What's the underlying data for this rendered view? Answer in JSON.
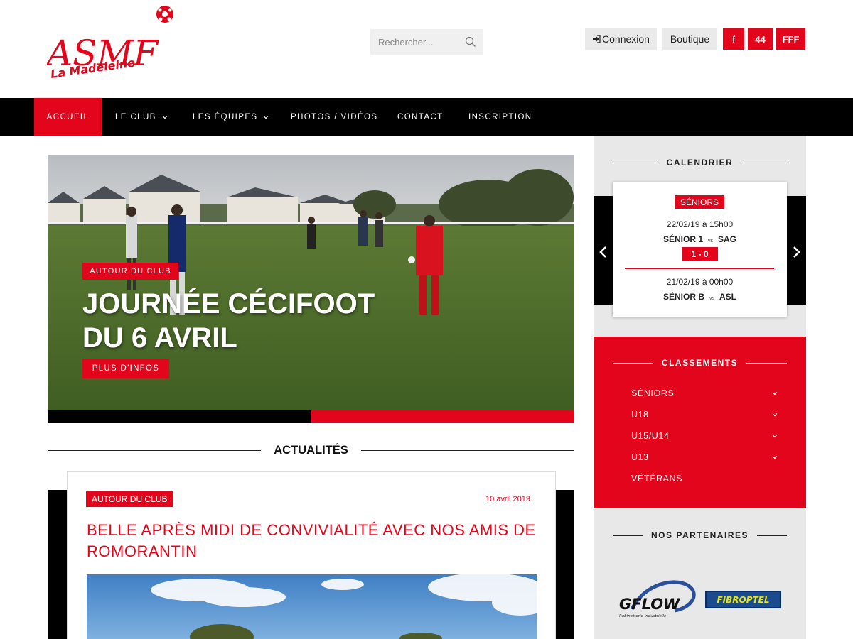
{
  "header": {
    "logo": {
      "main": "ASMF",
      "sub": "La Madeleine"
    },
    "search": {
      "placeholder": "Rechercher..."
    },
    "connexion_label": "Connexion",
    "boutique_label": "Boutique",
    "social": {
      "facebook": "f",
      "district": "44",
      "fff": "FFF"
    }
  },
  "nav": {
    "items": [
      {
        "label": "Accueil",
        "active": true
      },
      {
        "label": "Le Club",
        "dropdown": true
      },
      {
        "label": "Les Équipes",
        "dropdown": true
      },
      {
        "label": "Photos / Vidéos"
      },
      {
        "label": "Contact"
      },
      {
        "label": "Inscription"
      }
    ]
  },
  "hero": {
    "tag": "AUTOUR DU CLUB",
    "title_line1": "JOURNÉE CÉCIFOOT",
    "title_line2": "DU 6 AVRIL",
    "button": "PLUS D'INFOS",
    "progress": 0.5
  },
  "news": {
    "section_title": "ACTUALITÉS",
    "article": {
      "tag": "AUTOUR DU CLUB",
      "date": "10 avril 2019",
      "title": "BELLE APRÈS MIDI DE CONVIVIALITÉ AVEC NOS AMIS DE ROMORANTIN"
    }
  },
  "sidebar": {
    "calendar": {
      "title": "CALENDRIER",
      "category": "SÉNIORS",
      "matches": [
        {
          "date": "22/02/19 à 15h00",
          "home": "SÉNIOR 1",
          "vs": "vs",
          "away": "SAG",
          "score": "1 - 0"
        },
        {
          "date": "21/02/19 à 00h00",
          "home": "SÉNIOR B",
          "vs": "vs",
          "away": "ASL"
        }
      ]
    },
    "rankings": {
      "title": "CLASSEMENTS",
      "items": [
        {
          "label": "SÉNIORS",
          "dropdown": true
        },
        {
          "label": "U18",
          "dropdown": true
        },
        {
          "label": "U15/U14",
          "dropdown": true
        },
        {
          "label": "U13",
          "dropdown": true
        },
        {
          "label": "VÉTÉRANS",
          "dropdown": false
        }
      ]
    },
    "partners": {
      "title": "NOS PARTENAIRES",
      "logos": [
        {
          "name": "GFLOW",
          "tagline": "Robinetterie industrielle"
        },
        {
          "name": "FIBROPTEL"
        }
      ]
    }
  },
  "colors": {
    "accent": "#e3051b",
    "nav_bg": "#000000",
    "sidebar_bg": "#e8e8e8"
  }
}
